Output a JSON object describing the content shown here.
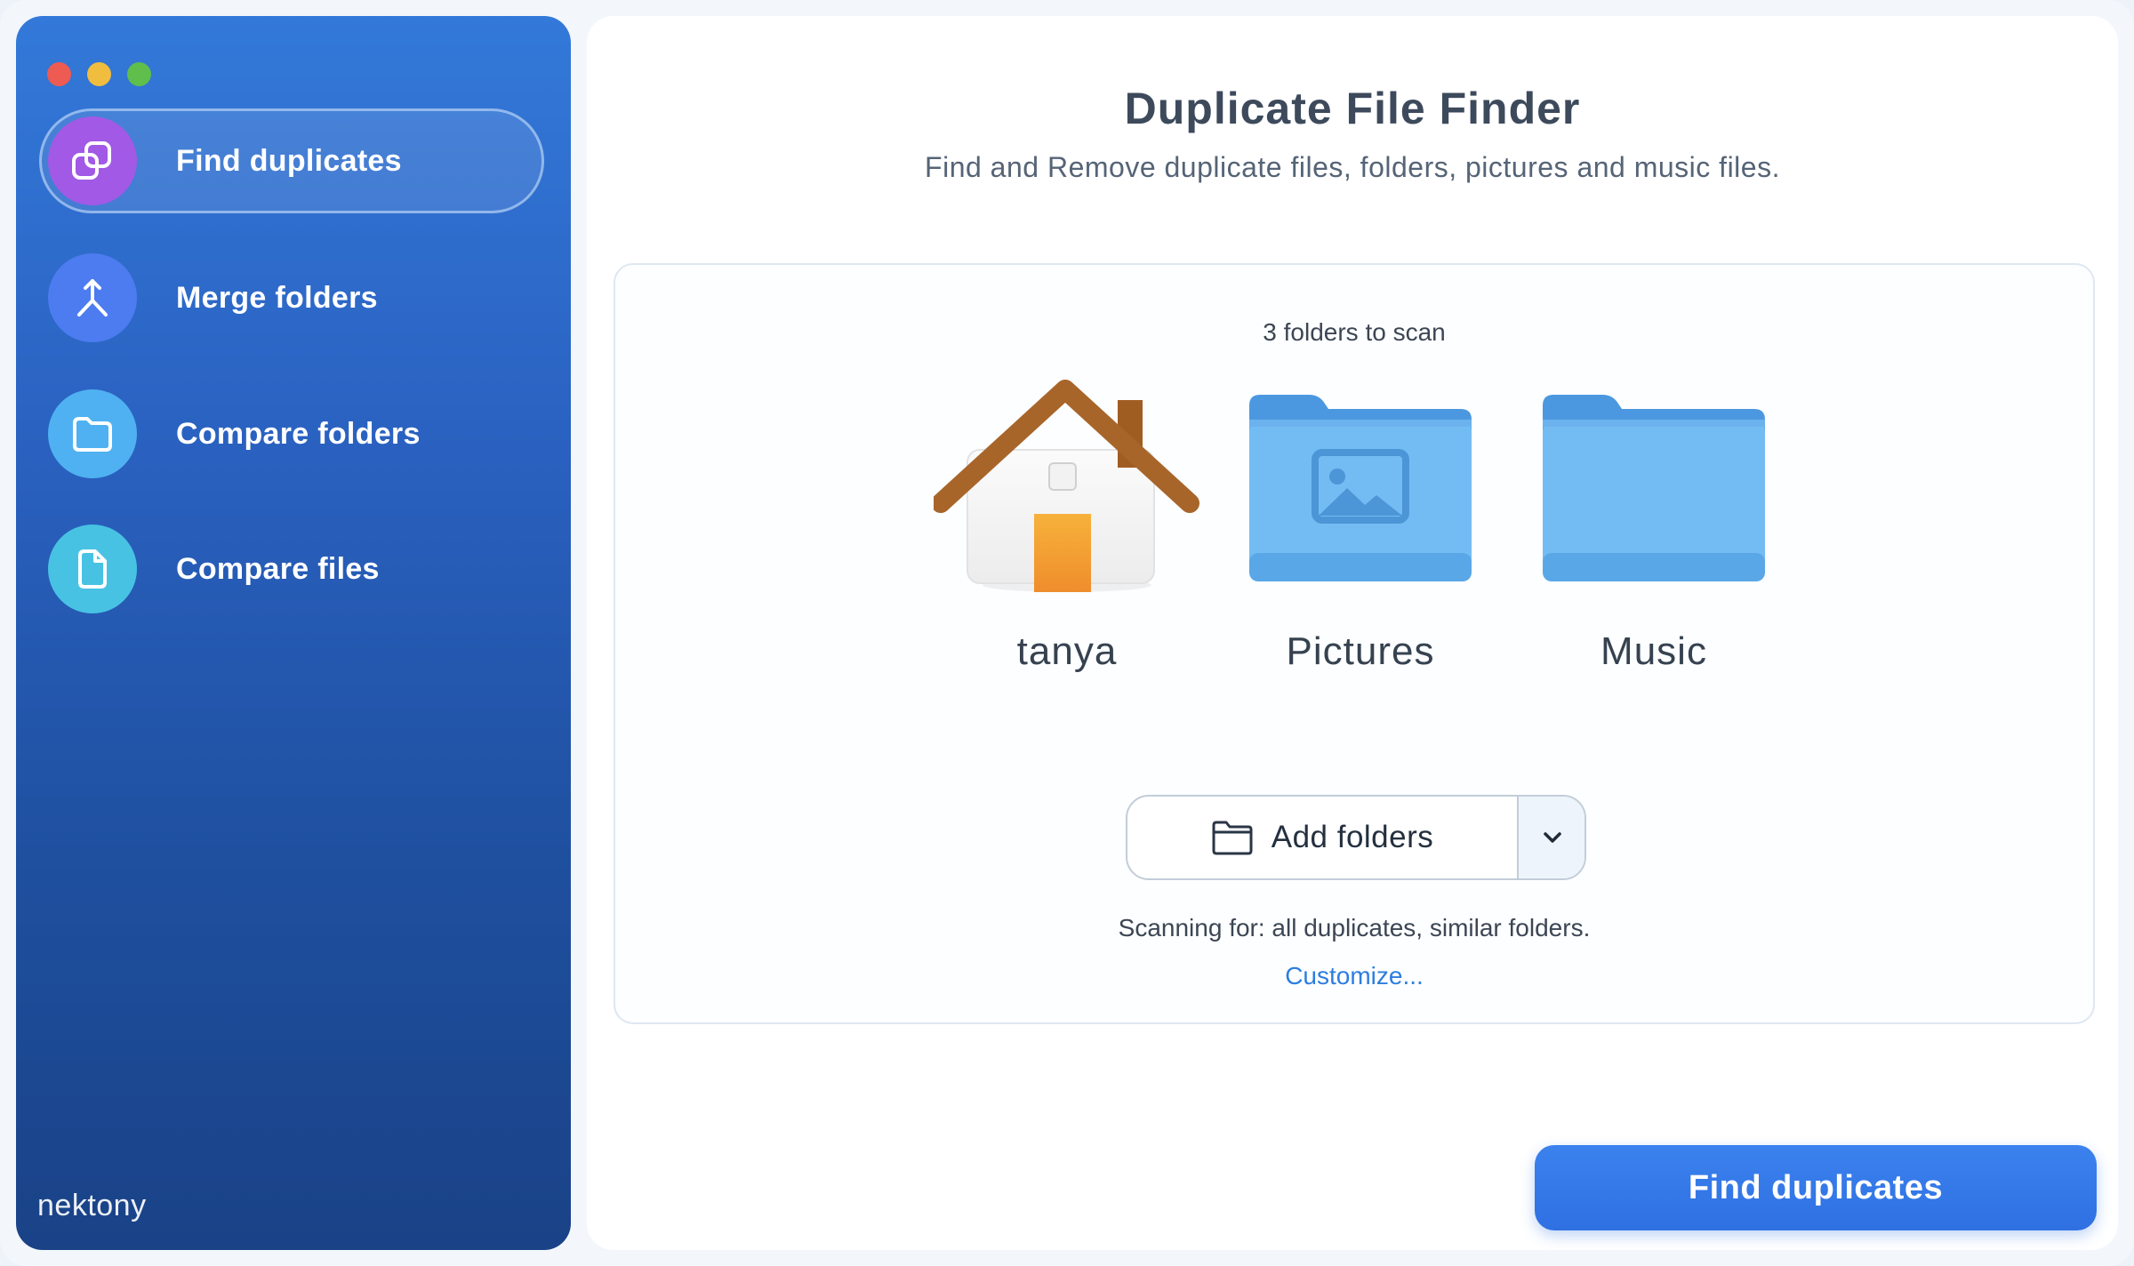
{
  "sidebar": {
    "items": [
      {
        "label": "Find duplicates",
        "icon": "duplicate-icon",
        "color": "#a259e6",
        "active": true
      },
      {
        "label": "Merge folders",
        "icon": "merge-icon",
        "color": "#4d7cf0",
        "active": false
      },
      {
        "label": "Compare folders",
        "icon": "folder-icon",
        "color": "#4fb1f1",
        "active": false
      },
      {
        "label": "Compare files",
        "icon": "file-icon",
        "color": "#48c2e3",
        "active": false
      }
    ],
    "brand": "nektony"
  },
  "main": {
    "title": "Duplicate File Finder",
    "subtitle": "Find and Remove duplicate files, folders, pictures and music files.",
    "scan": {
      "count_text": "3 folders to scan",
      "folders": [
        {
          "name": "tanya",
          "icon": "home-folder-icon"
        },
        {
          "name": "Pictures",
          "icon": "pictures-folder-icon"
        },
        {
          "name": "Music",
          "icon": "music-folder-icon"
        }
      ],
      "add_folders_label": "Add folders",
      "scanning_for": "Scanning for: all duplicates, similar folders.",
      "customize": "Customize..."
    },
    "primary_button": "Find duplicates"
  },
  "colors": {
    "accent": "#2f70e2",
    "link": "#2d7de0",
    "folder_blue": "#6fb8f2"
  }
}
